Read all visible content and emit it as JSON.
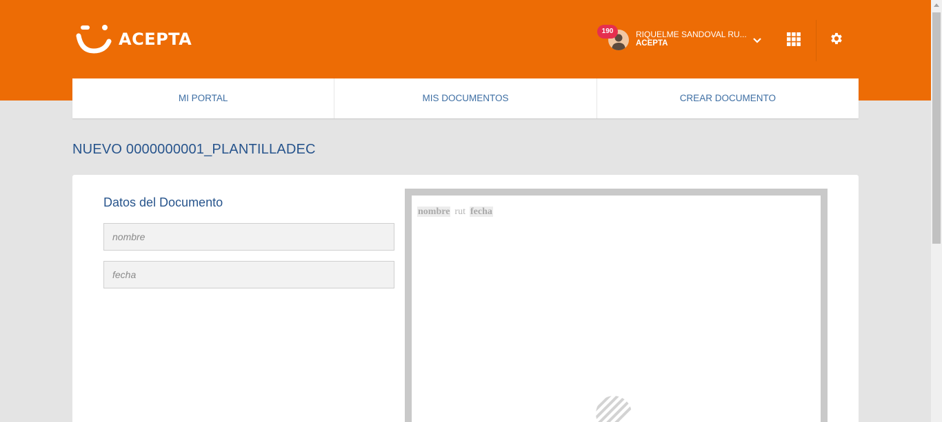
{
  "header": {
    "logo_text": "ACEPTA",
    "brand_color": "#ed6c05",
    "notifications_count": "190",
    "user_name": "RIQUELME SANDOVAL RU...",
    "user_org": "ACEPTA",
    "icons": [
      "avatar",
      "chevron-down-icon",
      "apps-grid-icon",
      "gear-icon"
    ]
  },
  "nav": {
    "items": [
      {
        "label": "MI PORTAL"
      },
      {
        "label": "MIS DOCUMENTOS"
      },
      {
        "label": "CREAR DOCUMENTO"
      }
    ]
  },
  "page": {
    "title": "NUEVO 0000000001_PLANTILLADEC"
  },
  "form": {
    "section_title": "Datos del Documento",
    "fields": [
      {
        "placeholder": "nombre",
        "value": ""
      },
      {
        "placeholder": "fecha",
        "value": ""
      }
    ]
  },
  "preview": {
    "tokens": [
      "nombre",
      "rut",
      "fecha"
    ]
  },
  "colors": {
    "accent_blue": "#27548c",
    "page_bg": "#e4e4e4"
  }
}
